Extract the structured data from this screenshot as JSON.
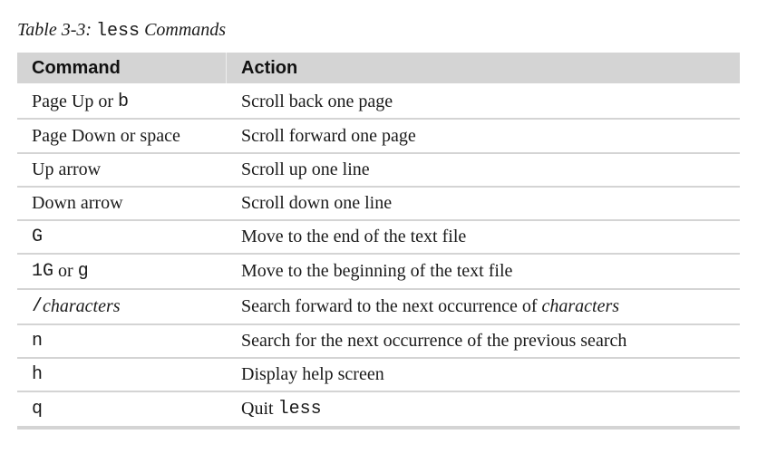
{
  "caption": {
    "prefix": "Table 3-3: ",
    "code": "less",
    "suffix": " Commands"
  },
  "table": {
    "headers": [
      "Command",
      "Action"
    ],
    "rows": [
      {
        "command": [
          {
            "t": "Page Up or "
          },
          {
            "t": "b",
            "mono": true
          }
        ],
        "action": [
          {
            "t": "Scroll back one page"
          }
        ]
      },
      {
        "command": [
          {
            "t": "Page Down or space"
          }
        ],
        "action": [
          {
            "t": "Scroll forward one page"
          }
        ]
      },
      {
        "command": [
          {
            "t": "Up arrow"
          }
        ],
        "action": [
          {
            "t": "Scroll up one line"
          }
        ]
      },
      {
        "command": [
          {
            "t": "Down arrow"
          }
        ],
        "action": [
          {
            "t": "Scroll down one line"
          }
        ]
      },
      {
        "command": [
          {
            "t": "G",
            "mono": true
          }
        ],
        "action": [
          {
            "t": "Move to the end of the text file"
          }
        ]
      },
      {
        "command": [
          {
            "t": "1G",
            "mono": true
          },
          {
            "t": " or "
          },
          {
            "t": "g",
            "mono": true
          }
        ],
        "action": [
          {
            "t": "Move to the beginning of the text file"
          }
        ]
      },
      {
        "command": [
          {
            "t": "/",
            "mono": true
          },
          {
            "t": "characters",
            "italic": true
          }
        ],
        "action": [
          {
            "t": "Search forward to the next occurrence of "
          },
          {
            "t": "characters",
            "italic": true
          }
        ]
      },
      {
        "command": [
          {
            "t": "n",
            "mono": true
          }
        ],
        "action": [
          {
            "t": "Search for the next occurrence of the previous search"
          }
        ]
      },
      {
        "command": [
          {
            "t": "h",
            "mono": true
          }
        ],
        "action": [
          {
            "t": "Display help screen"
          }
        ]
      },
      {
        "command": [
          {
            "t": "q",
            "mono": true
          }
        ],
        "action": [
          {
            "t": "Quit "
          },
          {
            "t": "less",
            "mono": true
          }
        ]
      }
    ]
  },
  "colors": {
    "header_bg": "#d4d4d4",
    "rule": "#d4d4d4",
    "text": "#1a1a1a"
  }
}
